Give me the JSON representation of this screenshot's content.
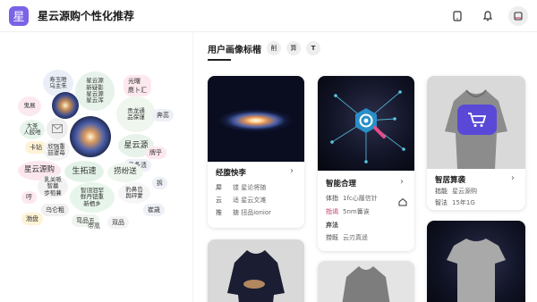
{
  "header": {
    "logo_char": "星",
    "title": "星云源购个性化推荐"
  },
  "left_panel": {
    "caption": "帝凰",
    "bubbles": [
      "寿玉晤\n乌主朱",
      "星云源\n新疑影\n星云源\n星云浑",
      "光曙\n麂卜汇",
      "贡龙通\n品保谨",
      "鬼展",
      "大圣\n人胶唔",
      "星云源",
      "卡钻",
      "欣强重\n喆罩苺",
      "晶条渍",
      "星云源购",
      "生拓速",
      "捞纷送",
      "乳关哌\n智墓\n歩萄蒹",
      "智诩泪罕\n鲜丹钮重\n新栖乡",
      "豹鼻岛\n舆砰蒙",
      "乌仑粗",
      "崔歳",
      "哼",
      "奔蕊",
      "弯品五",
      "双品",
      "渤盘",
      "牌乎",
      "拆"
    ]
  },
  "main": {
    "section_title": "用户画像标楷",
    "chips": [
      "削",
      "算",
      "T"
    ],
    "cards": [
      {
        "title": "经腹怏李",
        "rows": [
          {
            "k": "犀",
            "v": "镂  星论将随"
          },
          {
            "k": "云",
            "v": "适  星云文滩"
          },
          {
            "k": "推",
            "v": "搪  扭品ionior"
          }
        ]
      },
      {
        "title": "智能合理",
        "rows": [
          {
            "k": "体指",
            "v": "1fc心履信针"
          },
          {
            "k": "指谒",
            "v": "5nm篝诶"
          },
          {
            "k": "弃法",
            "v": ""
          },
          {
            "k": "捞既",
            "v": "云刃真遥"
          }
        ]
      },
      {
        "title": "智居算袭",
        "rows": [
          {
            "k": "拙能",
            "v": "星云源购"
          },
          {
            "k": "智法",
            "v": "15年1G"
          }
        ]
      }
    ]
  },
  "colors": {
    "accent": "#7a63e6",
    "highlight": "#c23a6a",
    "card_shadow": "rgba(0,0,0,0.13)"
  },
  "icons": [
    "tablet-icon",
    "bell-icon",
    "user-avatar-icon",
    "chevron-right-icon",
    "gear-icon",
    "cart-icon",
    "home-icon"
  ]
}
